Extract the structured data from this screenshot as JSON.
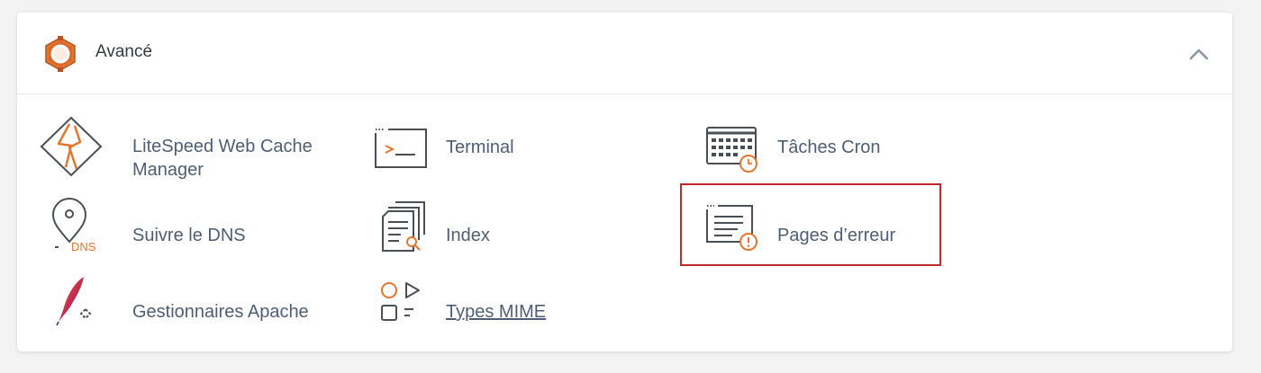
{
  "section": {
    "title": "Avancé",
    "icon": "gear-icon",
    "accent_color": "#e3762f",
    "collapse_icon": "chevron-up-icon"
  },
  "items": [
    {
      "label": "LiteSpeed Web Cache Manager",
      "label_line1": "LiteSpeed Web Cache",
      "label_line2": "Manager",
      "icon": "litespeed-icon"
    },
    {
      "label": "Terminal",
      "icon": "terminal-icon"
    },
    {
      "label": "Tâches Cron",
      "icon": "cron-calendar-icon"
    },
    {
      "label": "Suivre le DNS",
      "icon": "dns-pin-icon",
      "icon_text": "DNS"
    },
    {
      "label": "Index",
      "icon": "index-search-icon"
    },
    {
      "label": "Pages d’erreur",
      "icon": "error-page-icon",
      "highlighted": true,
      "highlight_color": "#c2292c"
    },
    {
      "label": "Gestionnaires Apache",
      "icon": "apache-feather-icon"
    },
    {
      "label": "Types MIME",
      "icon": "mime-types-icon",
      "underlined": true
    }
  ]
}
